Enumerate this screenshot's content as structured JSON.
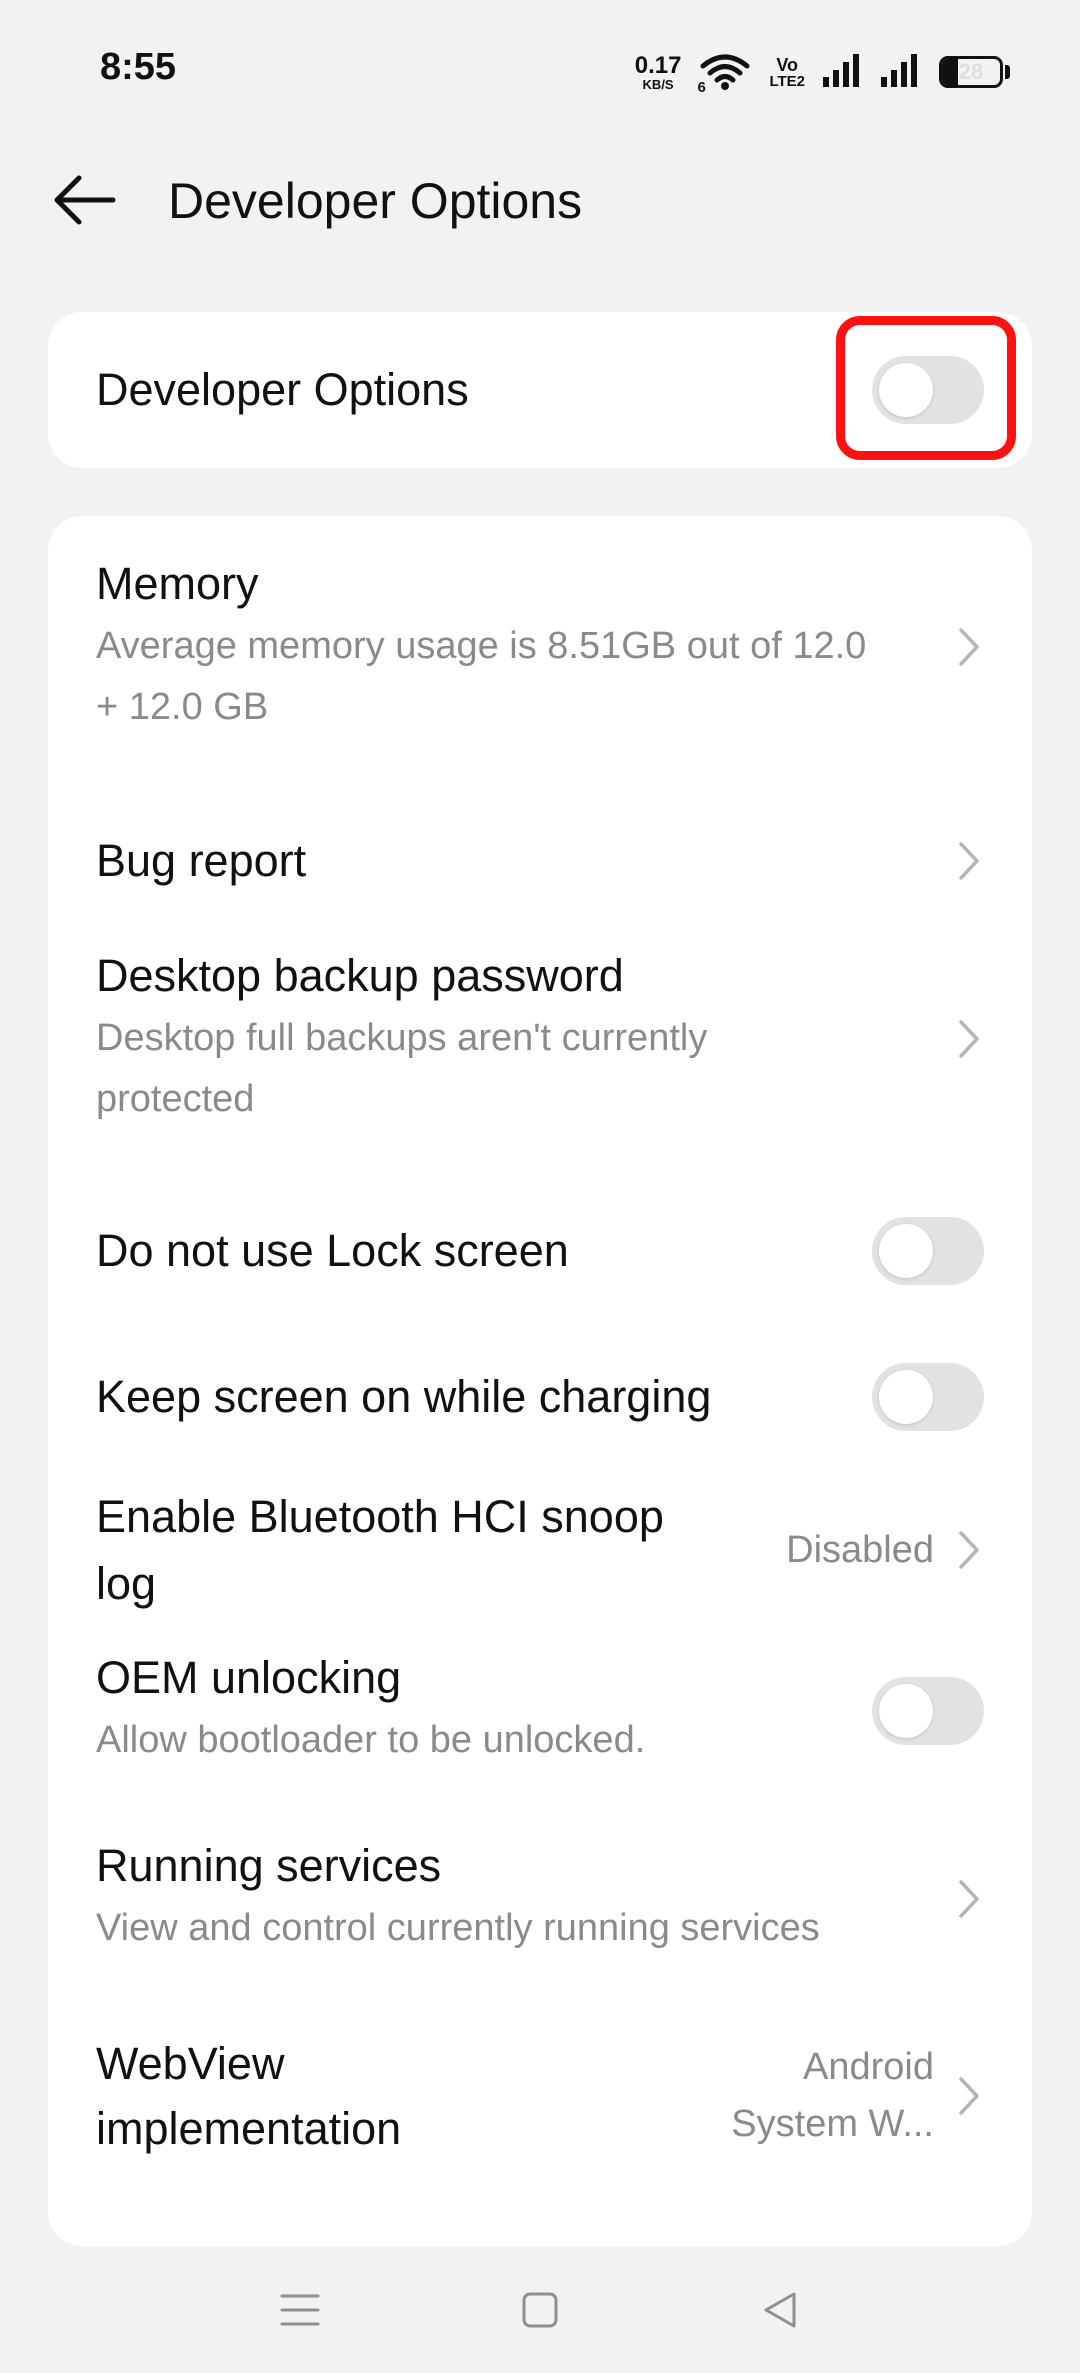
{
  "status_bar": {
    "time": "8:55",
    "net_speed_value": "0.17",
    "net_speed_unit": "KB/S",
    "wifi_label": "6",
    "volte_top": "Vo",
    "volte_bottom": "LTE2",
    "battery_level": "28",
    "battery_fraction": 0.28
  },
  "header": {
    "title": "Developer Options",
    "back_icon": "arrow-left-icon"
  },
  "master": {
    "label": "Developer Options",
    "enabled": false
  },
  "settings": {
    "memory": {
      "title": "Memory",
      "subtitle": "Average memory usage is 8.51GB out of 12.0 + 12.0 GB"
    },
    "bug_report": {
      "title": "Bug report"
    },
    "desktop_backup": {
      "title": "Desktop backup password",
      "subtitle": "Desktop full backups aren't currently protected"
    },
    "lock_screen": {
      "title": "Do not use Lock screen",
      "enabled": false
    },
    "keep_screen_on": {
      "title": "Keep screen on while charging",
      "enabled": false
    },
    "bt_hci": {
      "title": "Enable Bluetooth HCI snoop log",
      "value": "Disabled"
    },
    "oem_unlocking": {
      "title": "OEM unlocking",
      "subtitle": "Allow bootloader to be unlocked.",
      "enabled": false
    },
    "running_services": {
      "title": "Running services",
      "subtitle": "View and control currently running services"
    },
    "webview": {
      "title": "WebView implementation",
      "value": "Android System W..."
    }
  },
  "nav": {
    "menu_icon": "menu-icon",
    "home_icon": "square-home-icon",
    "back_icon": "triangle-back-icon"
  },
  "colors": {
    "background": "#f0f2f3",
    "card": "#ffffff",
    "highlight": "#ff1111",
    "toggle_off": "#e2e2e2",
    "secondary_text": "#8a8a8a"
  }
}
